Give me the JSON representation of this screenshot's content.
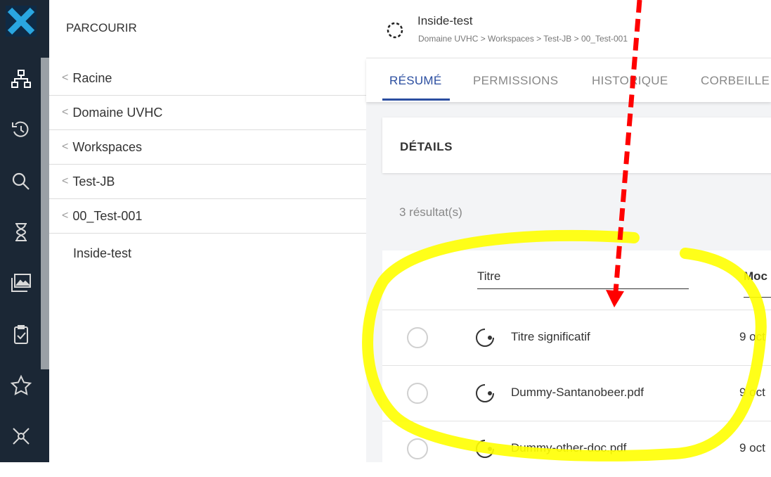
{
  "sidebar": {
    "title": "PARCOURIR",
    "crumbs": [
      {
        "label": "Racine"
      },
      {
        "label": "Domaine UVHC"
      },
      {
        "label": "Workspaces"
      },
      {
        "label": "Test-JB"
      },
      {
        "label": "00_Test-001"
      }
    ],
    "current": "Inside-test"
  },
  "rail": {
    "icons": [
      "logo-x-icon",
      "hierarchy-icon",
      "history-icon",
      "search-icon",
      "hourglass-icon",
      "image-gallery-icon",
      "task-checklist-icon",
      "star-icon",
      "network-icon"
    ]
  },
  "header": {
    "doc_title": "Inside-test",
    "breadcrumb": "Domaine UVHC > Workspaces > Test-JB > 00_Test-001"
  },
  "tabs": [
    {
      "label": "RÉSUMÉ",
      "active": true
    },
    {
      "label": "PERMISSIONS",
      "active": false
    },
    {
      "label": "HISTORIQUE",
      "active": false
    },
    {
      "label": "CORBEILLE",
      "active": false
    }
  ],
  "details": {
    "label": "DÉTAILS"
  },
  "results": {
    "count_text": "3 résultat(s)",
    "columns": {
      "title": "Titre",
      "modified": "Moc"
    },
    "rows": [
      {
        "name": "Titre significatif",
        "date": "9 oct"
      },
      {
        "name": "Dummy-Santanobeer.pdf",
        "date": "9 oct"
      },
      {
        "name": "Dummy-other-doc.pdf",
        "date": "9 oct"
      }
    ]
  },
  "colors": {
    "accent": "#2b4ea0",
    "rail_bg": "#1b2735",
    "logo": "#2aa6e0",
    "highlight": "#ffff00",
    "arrow": "#ff0000"
  }
}
